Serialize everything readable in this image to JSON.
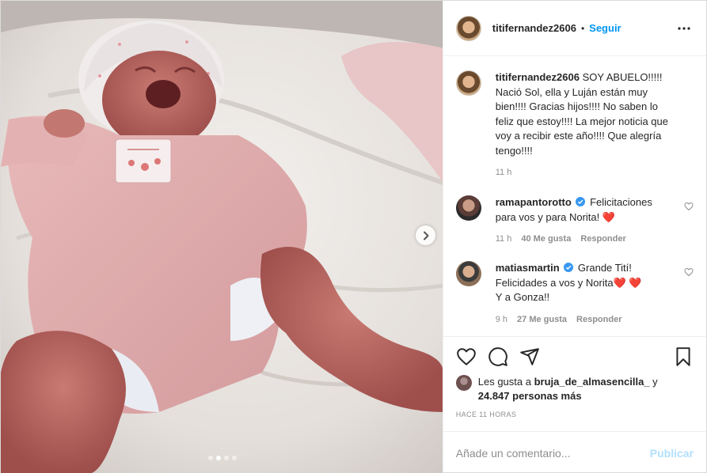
{
  "post": {
    "author": "titifernandez2606",
    "separator": "•",
    "follow_label": "Seguir",
    "carousel": {
      "slide_count": 4,
      "active_slide": 2
    },
    "caption": {
      "username": "titifernandez2606",
      "text": "SOY ABUELO!!!!! Nació Sol, ella y Luján están muy bien!!!! Gracias hijos!!!! No saben lo feliz que estoy!!!! La mejor noticia que voy a recibir este año!!!! Que alegría tengo!!!!",
      "age": "11 h"
    },
    "comments": [
      {
        "username": "ramapantorotto",
        "verified": true,
        "text": "Felicitaciones para vos y para Norita! ",
        "emoji": "❤️",
        "age": "11 h",
        "likes": "40 Me gusta",
        "reply_label": "Responder"
      },
      {
        "username": "matiasmartin",
        "verified": true,
        "line1": "Grande Tití!",
        "line2": "Felicidades a vos y Norita",
        "emoji": "❤️ ❤️",
        "line3": "Y a Gonza!!",
        "age": "9 h",
        "likes": "27 Me gusta",
        "reply_label": "Responder"
      }
    ],
    "likes": {
      "prefix": "Les gusta a ",
      "liker": "bruja_de_almasencilla_",
      "mid": " y",
      "count": "24.847 personas más"
    },
    "timestamp": "HACE 11 HORAS",
    "add_comment": {
      "placeholder": "Añade un comentario...",
      "publish_label": "Publicar"
    },
    "icons": {
      "more": "more-dots-icon",
      "next": "chevron-right-icon",
      "like": "heart-icon",
      "comment": "comment-bubble-icon",
      "share": "paper-plane-icon",
      "save": "bookmark-icon",
      "verified": "verified-badge-icon"
    },
    "colors": {
      "link": "#0095f6",
      "muted": "#8e8e8e",
      "heart": "#ed4956",
      "publish_disabled": "#b2dffc"
    }
  }
}
